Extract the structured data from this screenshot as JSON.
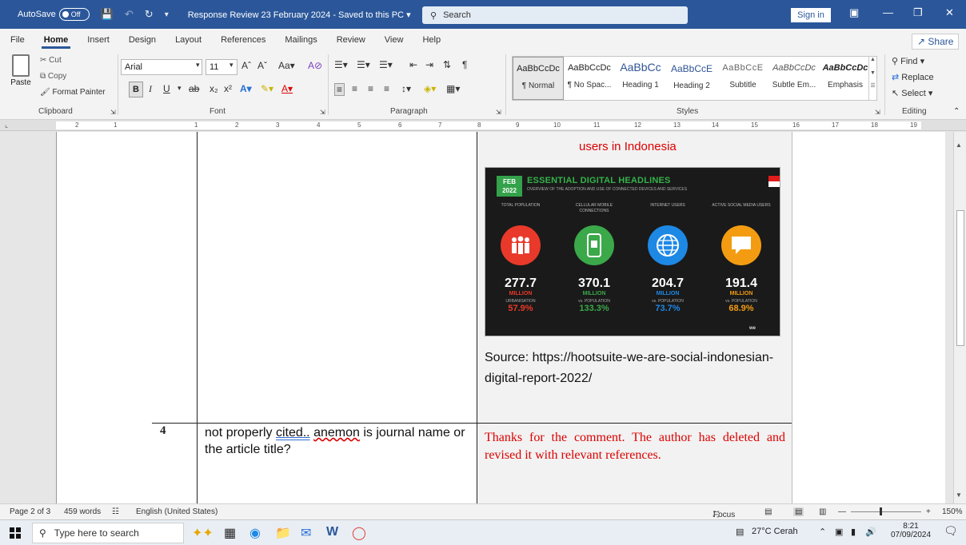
{
  "titlebar": {
    "autosave_label": "AutoSave",
    "autosave_state": "Off",
    "doc_title": "Response Review 23 February  2024 -  Saved to this PC",
    "search_label": "Search",
    "signin": "Sign in"
  },
  "menu": [
    "File",
    "Home",
    "Insert",
    "Design",
    "Layout",
    "References",
    "Mailings",
    "Review",
    "View",
    "Help"
  ],
  "share_label": "Share",
  "ribbon": {
    "paste": "Paste",
    "cut": "Cut",
    "copy": "Copy",
    "format_painter": "Format Painter",
    "font_name": "Arial",
    "font_size": "11",
    "groups": {
      "clipboard": "Clipboard",
      "font": "Font",
      "paragraph": "Paragraph",
      "styles": "Styles",
      "editing": "Editing"
    },
    "styles": [
      {
        "preview": "AaBbCcDc",
        "name": "¶ Normal"
      },
      {
        "preview": "AaBbCcDc",
        "name": "¶ No Spac..."
      },
      {
        "preview": "AaBbCc",
        "name": "Heading 1"
      },
      {
        "preview": "AaBbCcE",
        "name": "Heading 2"
      },
      {
        "preview": "AaBbCcE",
        "name": "Subtitle"
      },
      {
        "preview": "AaBbCcDc",
        "name": "Subtle Em..."
      },
      {
        "preview": "AaBbCcDc",
        "name": "Emphasis"
      }
    ],
    "editing": {
      "find": "Find",
      "replace": "Replace",
      "select": "Select"
    }
  },
  "ruler_numbers": [
    "2",
    "1",
    "1",
    "2",
    "3",
    "4",
    "5",
    "6",
    "7",
    "8",
    "9",
    "10",
    "11",
    "12",
    "13",
    "14",
    "15",
    "16",
    "17",
    "18",
    "19"
  ],
  "document": {
    "red_heading": "users in Indonesia",
    "infographic": {
      "badge_line1": "FEB",
      "badge_line2": "2022",
      "title": "ESSENTIAL DIGITAL HEADLINES",
      "subtitle": "OVERVIEW OF THE ADOPTION AND USE OF CONNECTED DEVICES AND SERVICES",
      "columns": [
        {
          "label": "TOTAL POPULATION",
          "value": "277.7",
          "unit": "MILLION",
          "sub": "URBANISATION",
          "pct": "57.9%",
          "color": "#e8392b"
        },
        {
          "label": "CELLULAR MOBILE CONNECTIONS",
          "value": "370.1",
          "unit": "MILLION",
          "sub": "vs. POPULATION",
          "pct": "133.3%",
          "color": "#3ba84a"
        },
        {
          "label": "INTERNET USERS",
          "value": "204.7",
          "unit": "MILLION",
          "sub": "vs. POPULATION",
          "pct": "73.7%",
          "color": "#1e88e5"
        },
        {
          "label": "ACTIVE SOCIAL MEDIA USERS",
          "value": "191.4",
          "unit": "MILLION",
          "sub": "vs. POPULATION",
          "pct": "68.9%",
          "color": "#f39c12"
        }
      ],
      "footer": "we"
    },
    "source_text": "Source: https://hootsuite-we-are-social-indonesian-digital-report-2022/",
    "row_number": "4",
    "comment_part1": "not properly ",
    "comment_cited": "cited..",
    "comment_space": " ",
    "comment_anemon": "anemon",
    "comment_part2": " is journal name or the article title?",
    "reply": "Thanks for the comment.   The author has deleted and revised it with relevant references."
  },
  "status": {
    "page": "Page 2 of 3",
    "words": "459 words",
    "language": "English (United States)",
    "focus": "Focus",
    "zoom": "150%"
  },
  "taskbar": {
    "search_placeholder": "Type here to search",
    "weather": "27°C  Cerah",
    "time": "8:21",
    "date": "07/09/2024"
  }
}
